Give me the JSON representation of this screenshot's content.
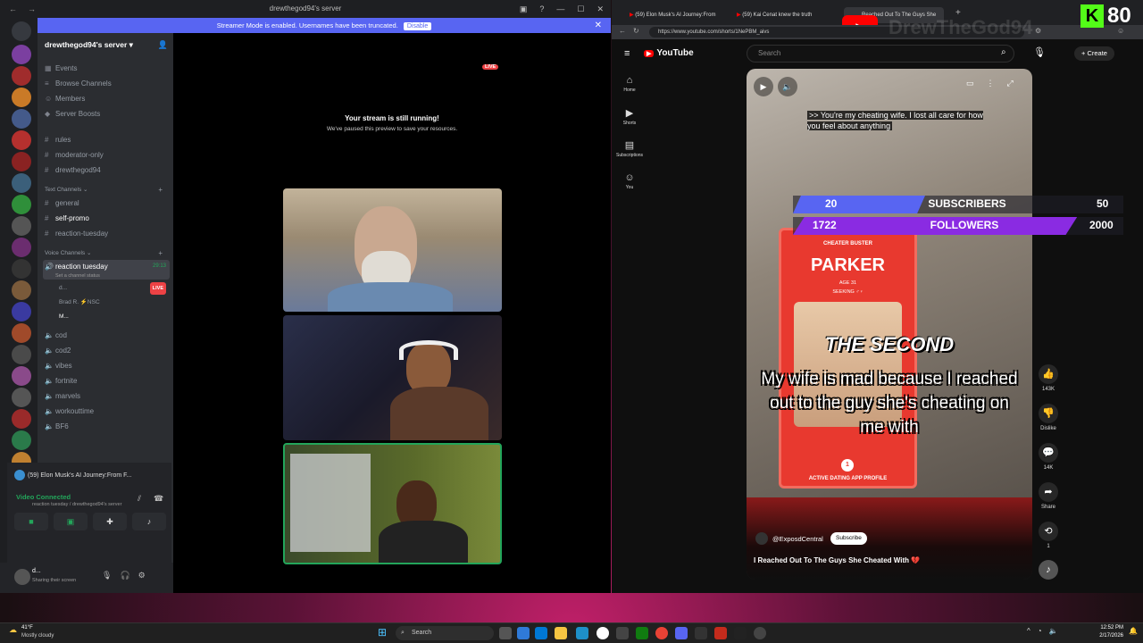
{
  "discord": {
    "window_title": "drewthegod94's server",
    "streamer_mode_text": "Streamer Mode is enabled. Usernames have been truncated.",
    "disable_label": "Disable",
    "server_name": "drewthegod94's server",
    "top_items": [
      "Events",
      "Browse Channels",
      "Members",
      "Server Boosts"
    ],
    "channels_top": [
      "rules",
      "moderator-only",
      "drewthegod94"
    ],
    "text_category": "Text Channels",
    "text_channels": [
      "general",
      "self-promo",
      "reaction-tuesday"
    ],
    "voice_category": "Voice Channels",
    "active_voice": "reaction tuesday",
    "active_voice_time": "29:13",
    "voice_status_placeholder": "Set a channel status",
    "voice_users": [
      {
        "name": "d...",
        "live": "LIVE"
      },
      {
        "name": "Brad R. ⚡NSC",
        "live": ""
      },
      {
        "name": "M...",
        "live": ""
      }
    ],
    "voice_channels": [
      "cod",
      "cod2",
      "vibes",
      "fortnite",
      "marvels",
      "workouttime",
      "BF6"
    ],
    "now_playing": "(59) Elon Musk's AI Journey:From F...",
    "vc_status": "Video Connected",
    "vc_sub": "reaction tuesday / drewthegod94's server",
    "user_name": "d...",
    "user_status": "Sharing their screen",
    "stream_live_badge": "LIVE",
    "stream_title": "Your stream is still running!",
    "stream_sub": "We've paused this preview to save your resources."
  },
  "youtube": {
    "tabs": [
      "(59) Elon Musk's AI Journey:From",
      "(59) Kai Cenat knew the truth",
      "Reached Out To The Guys She"
    ],
    "url": "https://www.youtube.com/shorts/1NePBM_aivs",
    "logo": "YouTube",
    "search_placeholder": "Search",
    "create_label": "Create",
    "nav": [
      "Home",
      "Shorts",
      "Subscriptions",
      "You"
    ],
    "caption": ">> You're my cheating wife. I lost all care for how you feel about anything",
    "card_brand": "CHEATER BUSTER",
    "card_name": "PARKER",
    "card_age": "AGE 31",
    "card_seeking": "SEEKING ♂♀",
    "card_footer": "ACTIVE DATING APP PROFILE",
    "card_number": "1",
    "overlay_heading": "THE SECOND",
    "overlay_text": "My wife is mad because I reached out to the guy she's cheating on me with",
    "channel": "@ExposdCentral",
    "subscribe_label": "Subscribe",
    "video_title": "I Reached Out To The Guys She Cheated With 💔",
    "likes": "143K",
    "dislike_label": "Dislike",
    "comments": "14K",
    "share_label": "Share",
    "remix_count": "1"
  },
  "overlay": {
    "k_count": "80",
    "subs_current": "20",
    "subs_label": "SUBSCRIBERS",
    "subs_goal": "50",
    "followers_current": "1722",
    "followers_label": "FOLLOWERS",
    "followers_goal": "2000",
    "subs_progress": 0.4,
    "followers_progress": 0.86,
    "watermark": "DrewTheGod94"
  },
  "taskbar": {
    "weather_temp": "41°F",
    "weather_desc": "Mostly cloudy",
    "search_label": "Search",
    "time": "12:52 PM",
    "date": "2/17/2026"
  },
  "colors": {
    "discord_blurple": "#5865f2",
    "youtube_red": "#ff0000",
    "live_red": "#ed4245",
    "purple_bar": "#8a2be2"
  }
}
